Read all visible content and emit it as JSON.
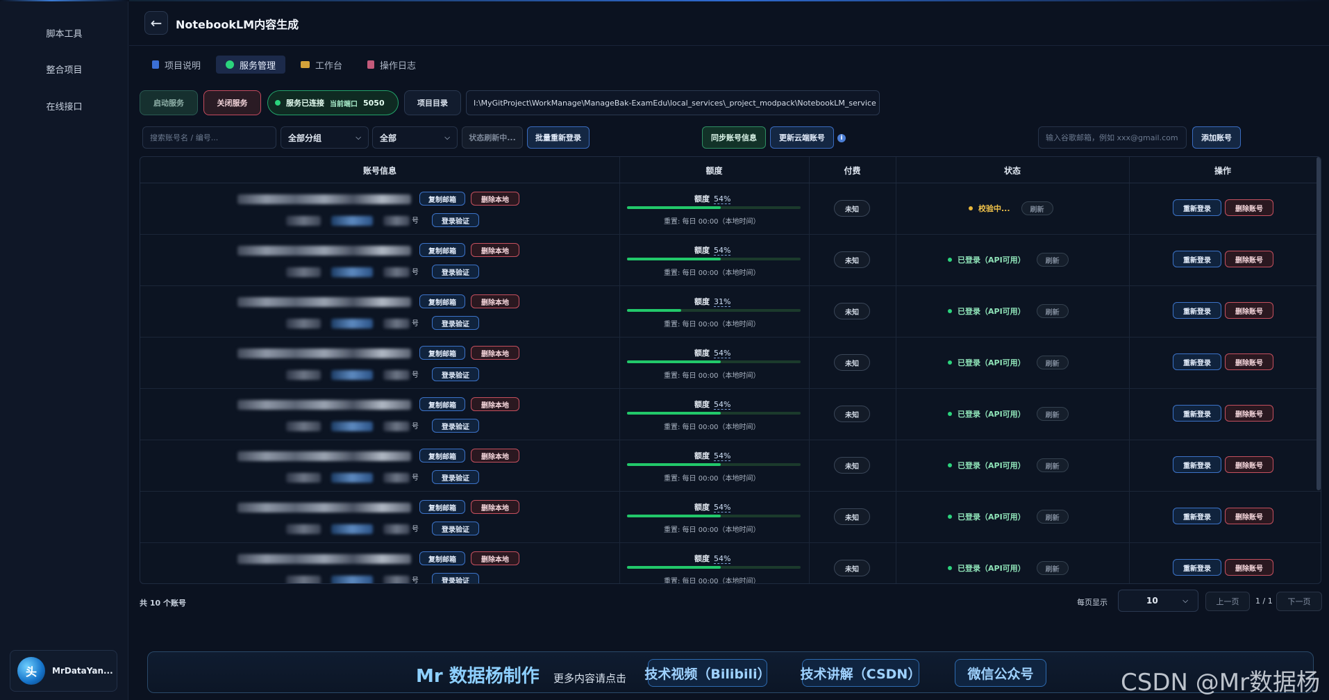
{
  "sidebar": {
    "items": [
      {
        "label": "脚本工具"
      },
      {
        "label": "整合项目"
      },
      {
        "label": "在线接口"
      }
    ],
    "user": {
      "name": "MrDataYan...",
      "avatar_text": "头"
    }
  },
  "header": {
    "back_icon": "←",
    "title": "NotebookLM内容生成"
  },
  "tabs": [
    {
      "label": "项目说明",
      "icon_color": "#3b6fd6"
    },
    {
      "label": "服务管理",
      "icon_color": "#2bd47d",
      "active": true
    },
    {
      "label": "工作台",
      "icon_color": "#d3a13a"
    },
    {
      "label": "操作日志",
      "icon_color": "#c35a7a"
    }
  ],
  "service": {
    "start_label": "启动服务",
    "stop_label": "关闭服务",
    "status_label": "服务已连接",
    "port_label": "当前端口",
    "port": "5050",
    "dir_label": "项目目录",
    "path": "I:\\MyGitProject\\WorkManage\\ManageBak-ExamEdu\\local_services\\_project_modpack\\NotebookLM_service"
  },
  "filters": {
    "search_placeholder": "搜索账号名 / 编号...",
    "group_select": "全部分组",
    "status_select": "全部",
    "status_refreshing": "状态刷新中...",
    "batch_relogin": "批量重新登录",
    "sync_info": "同步账号信息",
    "update_cloud": "更新云端账号",
    "info_icon": "i",
    "add_placeholder": "输入谷歌邮箱，例如 xxx@gmail.com",
    "add_button": "添加账号"
  },
  "table": {
    "headers": [
      "账号信息",
      "额度",
      "付费",
      "状态",
      "操作"
    ],
    "copy_email": "复制邮箱",
    "delete_local": "删除本地",
    "login_verify": "登录验证",
    "quota_label": "额度",
    "reset_text": "重置: 每日 00:00（本地时间）",
    "paid_text": "未知",
    "refresh_label": "刷新",
    "relogin": "重新登录",
    "delete_account": "删除账号",
    "truncated_char": "号",
    "rows": [
      {
        "quota": 54,
        "quota_text": "54%",
        "status": "校验中...",
        "status_color": "#e8b73a"
      },
      {
        "quota": 54,
        "quota_text": "54%",
        "status": "已登录（API可用）",
        "status_color": "#2bd47d"
      },
      {
        "quota": 31,
        "quota_text": "31%",
        "status": "已登录（API可用）",
        "status_color": "#2bd47d"
      },
      {
        "quota": 54,
        "quota_text": "54%",
        "status": "已登录（API可用）",
        "status_color": "#2bd47d"
      },
      {
        "quota": 54,
        "quota_text": "54%",
        "status": "已登录（API可用）",
        "status_color": "#2bd47d"
      },
      {
        "quota": 54,
        "quota_text": "54%",
        "status": "已登录（API可用）",
        "status_color": "#2bd47d"
      },
      {
        "quota": 54,
        "quota_text": "54%",
        "status": "已登录（API可用）",
        "status_color": "#2bd47d"
      },
      {
        "quota": 54,
        "quota_text": "54%",
        "status": "已登录（API可用）",
        "status_color": "#2bd47d"
      }
    ]
  },
  "pagination": {
    "total": "共 10 个账号",
    "per_page_label": "每页显示",
    "per_page": "10",
    "prev": "上一页",
    "page": "1 / 1",
    "next": "下一页"
  },
  "banner": {
    "brand": "Mr 数据杨制作",
    "sub": "更多内容请点击",
    "links": [
      "技术视频（Bilibili）",
      "技术讲解（CSDN）",
      "微信公众号"
    ]
  },
  "watermark": "CSDN @Mr数据杨"
}
